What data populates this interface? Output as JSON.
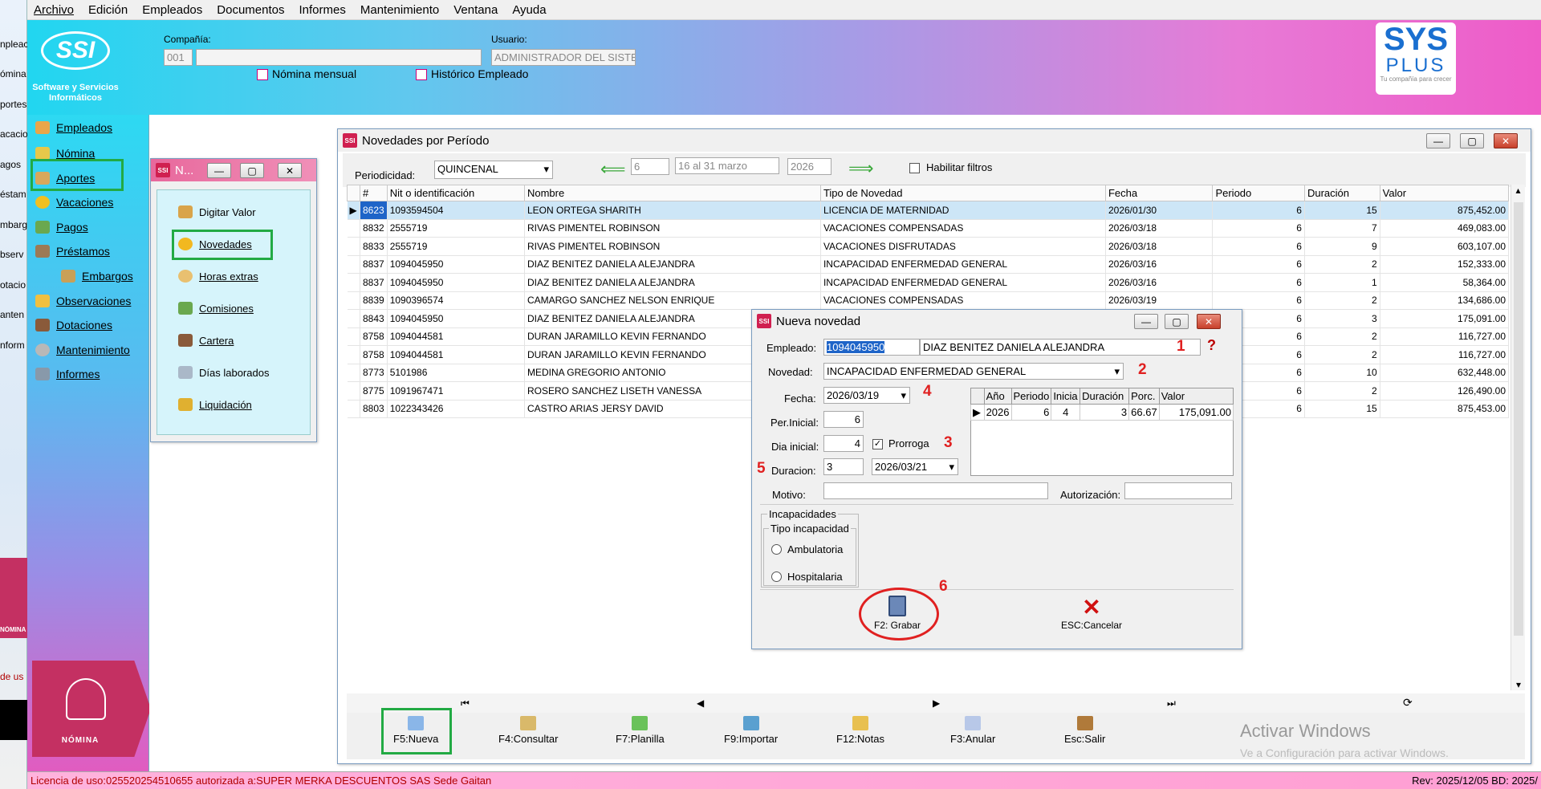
{
  "left_strip": {
    "items": [
      "npleac",
      "ómina",
      "portes",
      "acacio",
      "agos",
      "éstam",
      "mbarg",
      "bserv",
      "otacio",
      "anten",
      "nform"
    ],
    "badge_label": "NÓMINA",
    "lic_fragment": "de us"
  },
  "menu": [
    "Archivo",
    "Edición",
    "Empleados",
    "Documentos",
    "Informes",
    "Mantenimiento",
    "Ventana",
    "Ayuda"
  ],
  "header": {
    "logo_text": "SSI",
    "logo_caption": "Software y Servicios Informáticos",
    "company_label": "Compañía:",
    "company_code": "001",
    "company_name": "",
    "user_label": "Usuario:",
    "user_value": "ADMINISTRADOR DEL SISTEMA",
    "link1": "Nómina mensual",
    "link2": "Histórico Empleado",
    "brand_line1": "SYS",
    "brand_line2": "PLUS",
    "brand_tagline": "Tu compañía para crecer"
  },
  "sidebar": {
    "items": [
      "Empleados",
      "Nómina",
      "Aportes",
      "Vacaciones",
      "Pagos",
      "Préstamos",
      "Embargos",
      "Observaciones",
      "Dotaciones",
      "Mantenimiento",
      "Informes"
    ],
    "badge_label": "NÓMINA"
  },
  "submenu": {
    "title": "N...",
    "items": [
      "Digitar Valor",
      "Novedades",
      "Horas extras",
      "Comisiones",
      "Cartera",
      "Días laborados",
      "Liquidación"
    ]
  },
  "main": {
    "title": "Novedades por Período",
    "periodicidad_label": "Periodicidad:",
    "periodicidad": "QUINCENAL",
    "period_num": "6",
    "period_desc": "16 al 31 marzo",
    "year": "2026",
    "filter_label": "Habilitar filtros",
    "columns": [
      "#",
      "Nit o identificación",
      "Nombre",
      "Tipo de Novedad",
      "Fecha",
      "Periodo",
      "Duración",
      "Valor"
    ],
    "rows": [
      [
        "8623",
        "1093594504",
        "LEON ORTEGA SHARITH",
        "LICENCIA DE MATERNIDAD",
        "2026/01/30",
        "6",
        "15",
        "875,452.00"
      ],
      [
        "8832",
        "2555719",
        "RIVAS PIMENTEL ROBINSON",
        "VACACIONES COMPENSADAS",
        "2026/03/18",
        "6",
        "7",
        "469,083.00"
      ],
      [
        "8833",
        "2555719",
        "RIVAS PIMENTEL ROBINSON",
        "VACACIONES DISFRUTADAS",
        "2026/03/18",
        "6",
        "9",
        "603,107.00"
      ],
      [
        "8837",
        "1094045950",
        "DIAZ BENITEZ DANIELA ALEJANDRA",
        "INCAPACIDAD ENFERMEDAD GENERAL",
        "2026/03/16",
        "6",
        "2",
        "152,333.00"
      ],
      [
        "8837",
        "1094045950",
        "DIAZ BENITEZ DANIELA ALEJANDRA",
        "INCAPACIDAD ENFERMEDAD GENERAL",
        "2026/03/16",
        "6",
        "1",
        "58,364.00"
      ],
      [
        "8839",
        "1090396574",
        "CAMARGO SANCHEZ NELSON ENRIQUE",
        "VACACIONES COMPENSADAS",
        "2026/03/19",
        "6",
        "2",
        "134,686.00"
      ],
      [
        "8843",
        "1094045950",
        "DIAZ BENITEZ DANIELA ALEJANDRA",
        "",
        "",
        "6",
        "3",
        "175,091.00"
      ],
      [
        "8758",
        "1094044581",
        "DURAN JARAMILLO KEVIN FERNANDO",
        "",
        "",
        "6",
        "2",
        "116,727.00"
      ],
      [
        "8758",
        "1094044581",
        "DURAN JARAMILLO KEVIN FERNANDO",
        "",
        "",
        "6",
        "2",
        "116,727.00"
      ],
      [
        "8773",
        "5101986",
        "MEDINA  GREGORIO ANTONIO",
        "",
        "",
        "6",
        "10",
        "632,448.00"
      ],
      [
        "8775",
        "1091967471",
        "ROSERO SANCHEZ LISETH VANESSA",
        "",
        "",
        "6",
        "2",
        "126,490.00"
      ],
      [
        "8803",
        "1022343426",
        "CASTRO ARIAS JERSY DAVID",
        "",
        "",
        "6",
        "15",
        "875,453.00"
      ]
    ],
    "toolbar": [
      "F5:Nueva",
      "F4:Consultar",
      "F7:Planilla",
      "F9:Importar",
      "F12:Notas",
      "F3:Anular",
      "Esc:Salir"
    ],
    "watermark1": "Activar Windows",
    "watermark2": "Ve a Configuración para activar Windows."
  },
  "dialog": {
    "title": "Nueva novedad",
    "empleado_label": "Empleado:",
    "empleado_id": "1094045950",
    "empleado_name": "DIAZ BENITEZ DANIELA ALEJANDRA",
    "novedad_label": "Novedad:",
    "novedad": "INCAPACIDAD ENFERMEDAD GENERAL",
    "fecha_label": "Fecha:",
    "fecha": "2026/03/19",
    "per_inicial_label": "Per.Inicial:",
    "per_inicial": "6",
    "dia_inicial_label": "Dia inicial:",
    "dia_inicial": "4",
    "prorroga_label": "Prorroga",
    "duracion_label": "Duracion:",
    "duracion": "3",
    "fecha_fin": "2026/03/21",
    "motivo_label": "Motivo:",
    "autorizacion_label": "Autorización:",
    "sub_columns": [
      "Año",
      "Periodo",
      "Inicia",
      "Duración",
      "Porc.",
      "Valor"
    ],
    "sub_row": [
      "2026",
      "6",
      "4",
      "3",
      "66.67",
      "175,091.00"
    ],
    "incap_group": "Incapacidades",
    "tipo_group": "Tipo incapacidad",
    "radio1": "Ambulatoria",
    "radio2": "Hospitalaria",
    "save_label": "F2: Grabar",
    "cancel_label": "ESC:Cancelar",
    "help": "?"
  },
  "annotations": [
    "1",
    "2",
    "3",
    "4",
    "5",
    "6"
  ],
  "status": {
    "license": "Licencia de uso:025520254510655 autorizada a:SUPER MERKA DESCUENTOS SAS Sede Gaitan",
    "rev": "Rev: 2025/12/05 BD: 2025/"
  }
}
